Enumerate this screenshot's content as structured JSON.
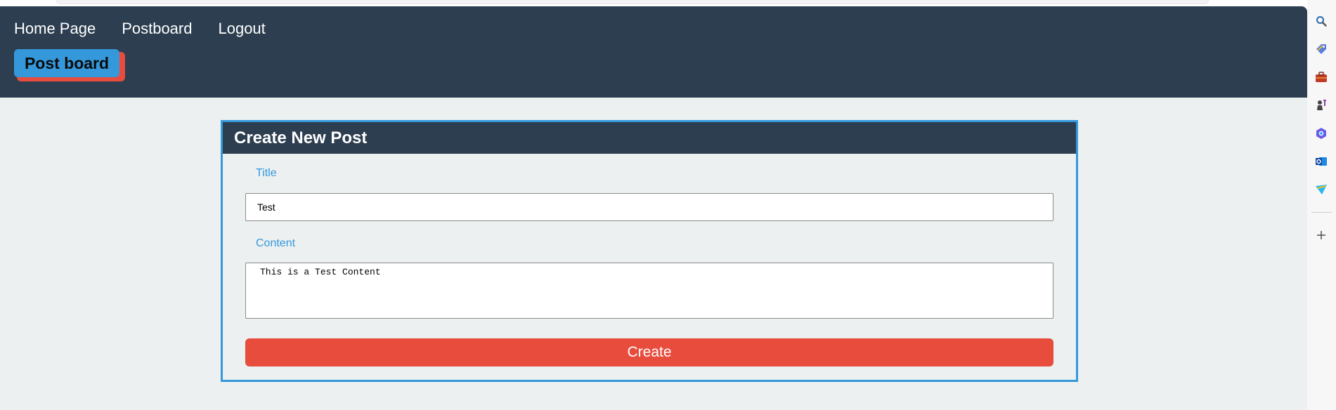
{
  "nav": {
    "links": [
      "Home Page",
      "Postboard",
      "Logout"
    ],
    "brand": "Post board"
  },
  "form": {
    "heading": "Create New Post",
    "title_label": "Title",
    "title_value": "Test",
    "content_label": "Content",
    "content_value": "This is a Test Content",
    "submit_label": "Create"
  },
  "sidebar": {
    "icons": [
      "search-icon",
      "tag-icon",
      "briefcase-icon",
      "chess-icon",
      "copilot-icon",
      "outlook-icon",
      "send-icon",
      "add-icon"
    ]
  },
  "colors": {
    "header_bg": "#2c3e50",
    "accent_blue": "#3498db",
    "accent_red": "#e74c3c",
    "page_bg": "#ecf0f1"
  }
}
